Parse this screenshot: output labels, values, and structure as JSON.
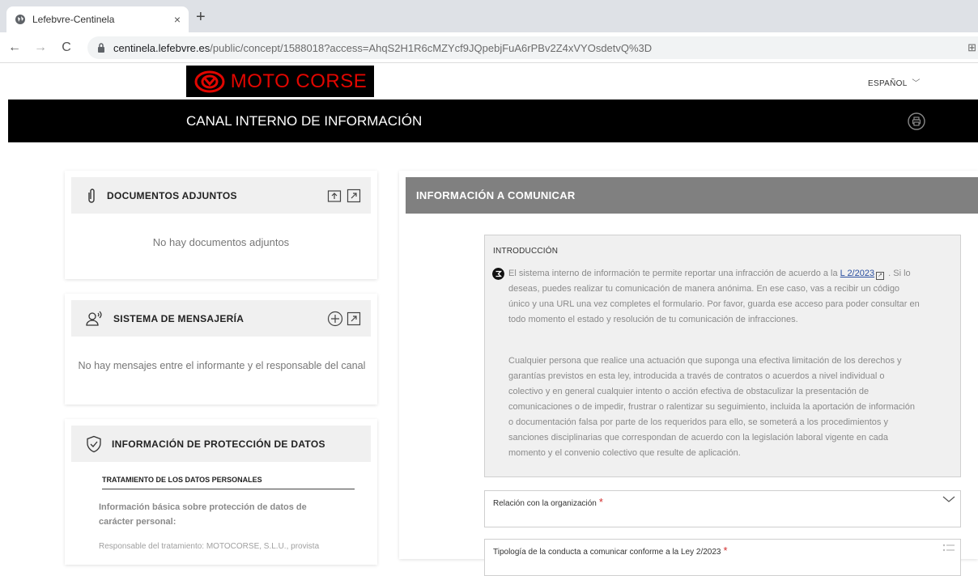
{
  "browser": {
    "tab_title": "Lefebvre-Centinela",
    "tab_close": "×",
    "new_tab": "+",
    "url_host": "centinela.lefebvre.es",
    "url_path": "/public/concept/1588018?access=AhqS2H1R6cMZYcf9JQpebjFuA6rPBv2Z4xVYOsdetvQ%3D"
  },
  "header": {
    "logo_text": "MOTO CORSE",
    "language": "ESPAÑOL",
    "title": "CANAL INTERNO DE INFORMACIÓN"
  },
  "sidebar": {
    "documents": {
      "title": "DOCUMENTOS ADJUNTOS",
      "empty": "No hay documentos adjuntos"
    },
    "messaging": {
      "title": "SISTEMA DE MENSAJERÍA",
      "empty": "No hay mensajes entre el informante y el responsable del canal"
    },
    "data_protection": {
      "title": "INFORMACIÓN DE PROTECCIÓN DE DATOS",
      "subtitle": "TRATAMIENTO DE LOS DATOS PERSONALES",
      "basic_info": "Información básica sobre protección de datos de carácter personal:",
      "responsible": "Responsable del tratamiento: MOTOCORSE, S.L.U., provista"
    }
  },
  "main": {
    "title": "INFORMACIÓN A COMUNICAR",
    "intro": {
      "heading": "INTRODUCCIÓN",
      "p1_before": "El sistema interno de información te permite reportar una infracción de acuerdo a la ",
      "p1_link": "L 2/2023",
      "p1_after": " . Si lo deseas, puedes realizar tu comunicación de manera anónima. En ese caso, vas a recibir un código único y una URL una vez completes el formulario. Por favor, guarda ese acceso para poder consultar en todo momento el estado y resolución de tu comunicación de infracciones.",
      "p2": "Cualquier persona que realice una actuación que suponga una efectiva limitación de los derechos y garantías previstos en esta ley, introducida a través de contratos o acuerdos a nivel individual o colectivo y en general cualquier intento o acción efectiva de obstaculizar la presentación de comunicaciones o de impedir, frustrar o ralentizar su seguimiento, incluida la aportación de información o documentación falsa por parte de los requeridos para ello, se someterá a los procedimientos y sanciones disciplinarias que correspondan de acuerdo con la legislación laboral vigente en cada momento y el convenio colectivo que resulte de aplicación."
    },
    "fields": {
      "relation_label": "Relación con la organización",
      "typology_label": "Tipología de la conducta a comunicar conforme a la Ley 2/2023",
      "required_mark": "*"
    }
  }
}
